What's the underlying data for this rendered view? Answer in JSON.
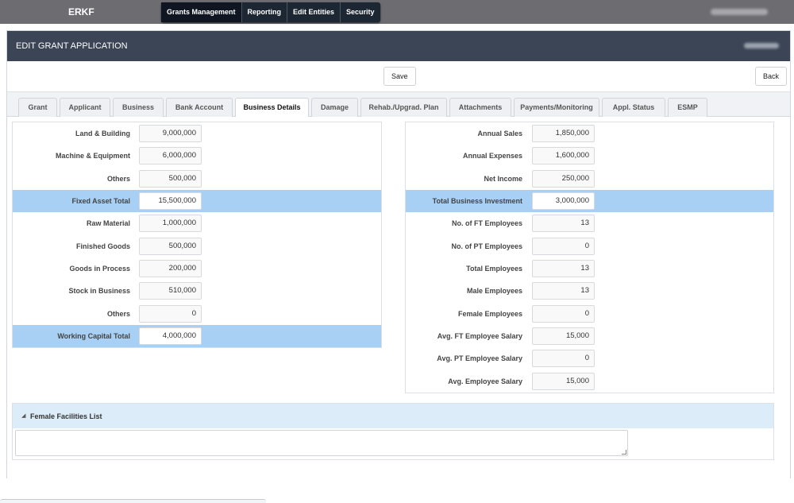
{
  "app": {
    "brand": "ERKF",
    "nav": [
      {
        "label": "Grants Management",
        "active": true
      },
      {
        "label": "Reporting",
        "active": false
      },
      {
        "label": "Edit Entities",
        "active": false
      },
      {
        "label": "Security",
        "active": false
      }
    ]
  },
  "panel": {
    "title": "EDIT GRANT APPLICATION"
  },
  "toolbar": {
    "save_label": "Save",
    "back_label": "Back"
  },
  "tabs": [
    {
      "label": "Grant",
      "active": false
    },
    {
      "label": "Applicant",
      "active": false
    },
    {
      "label": "Business",
      "active": false
    },
    {
      "label": "Bank Account",
      "active": false
    },
    {
      "label": "Business Details",
      "active": true
    },
    {
      "label": "Damage",
      "active": false
    },
    {
      "label": "Rehab./Upgrad. Plan",
      "active": false
    },
    {
      "label": "Attachments",
      "active": false
    },
    {
      "label": "Payments/Monitoring",
      "active": false
    },
    {
      "label": "Appl. Status",
      "active": false
    },
    {
      "label": "ESMP",
      "active": false
    }
  ],
  "left_fields": [
    {
      "label": "Land & Building",
      "value": "9,000,000",
      "total": false
    },
    {
      "label": "Machine & Equipment",
      "value": "6,000,000",
      "total": false
    },
    {
      "label": "Others",
      "value": "500,000",
      "total": false
    },
    {
      "label": "Fixed Asset Total",
      "value": "15,500,000",
      "total": true
    },
    {
      "label": "Raw Material",
      "value": "1,000,000",
      "total": false
    },
    {
      "label": "Finished Goods",
      "value": "500,000",
      "total": false
    },
    {
      "label": "Goods in Process",
      "value": "200,000",
      "total": false
    },
    {
      "label": "Stock in Business",
      "value": "510,000",
      "total": false
    },
    {
      "label": "Others",
      "value": "0",
      "total": false
    },
    {
      "label": "Working Capital Total",
      "value": "4,000,000",
      "total": true
    }
  ],
  "right_fields": [
    {
      "label": "Annual Sales",
      "value": "1,850,000",
      "total": false
    },
    {
      "label": "Annual Expenses",
      "value": "1,600,000",
      "total": false
    },
    {
      "label": "Net Income",
      "value": "250,000",
      "total": false
    },
    {
      "label": "Total Business Investment",
      "value": "3,000,000",
      "total": true
    },
    {
      "label": "No. of FT Employees",
      "value": "13",
      "total": false
    },
    {
      "label": "No. of PT Employees",
      "value": "0",
      "total": false
    },
    {
      "label": "Total Employees",
      "value": "13",
      "total": false
    },
    {
      "label": "Male Employees",
      "value": "13",
      "total": false
    },
    {
      "label": "Female Employees",
      "value": "0",
      "total": false
    },
    {
      "label": "Avg. FT Employee Salary",
      "value": "15,000",
      "total": false
    },
    {
      "label": "Avg. PT Employee Salary",
      "value": "0",
      "total": false
    },
    {
      "label": "Avg. Employee Salary",
      "value": "15,000",
      "total": false
    }
  ],
  "female_facilities": {
    "title": "Female Facilities List",
    "value": ""
  },
  "colors": {
    "topbar": "#6c6c71",
    "nav": "#1d2633",
    "panel_header": "#3b4555",
    "total_row": "#a7d0f4",
    "section_header": "#ddecf9"
  }
}
